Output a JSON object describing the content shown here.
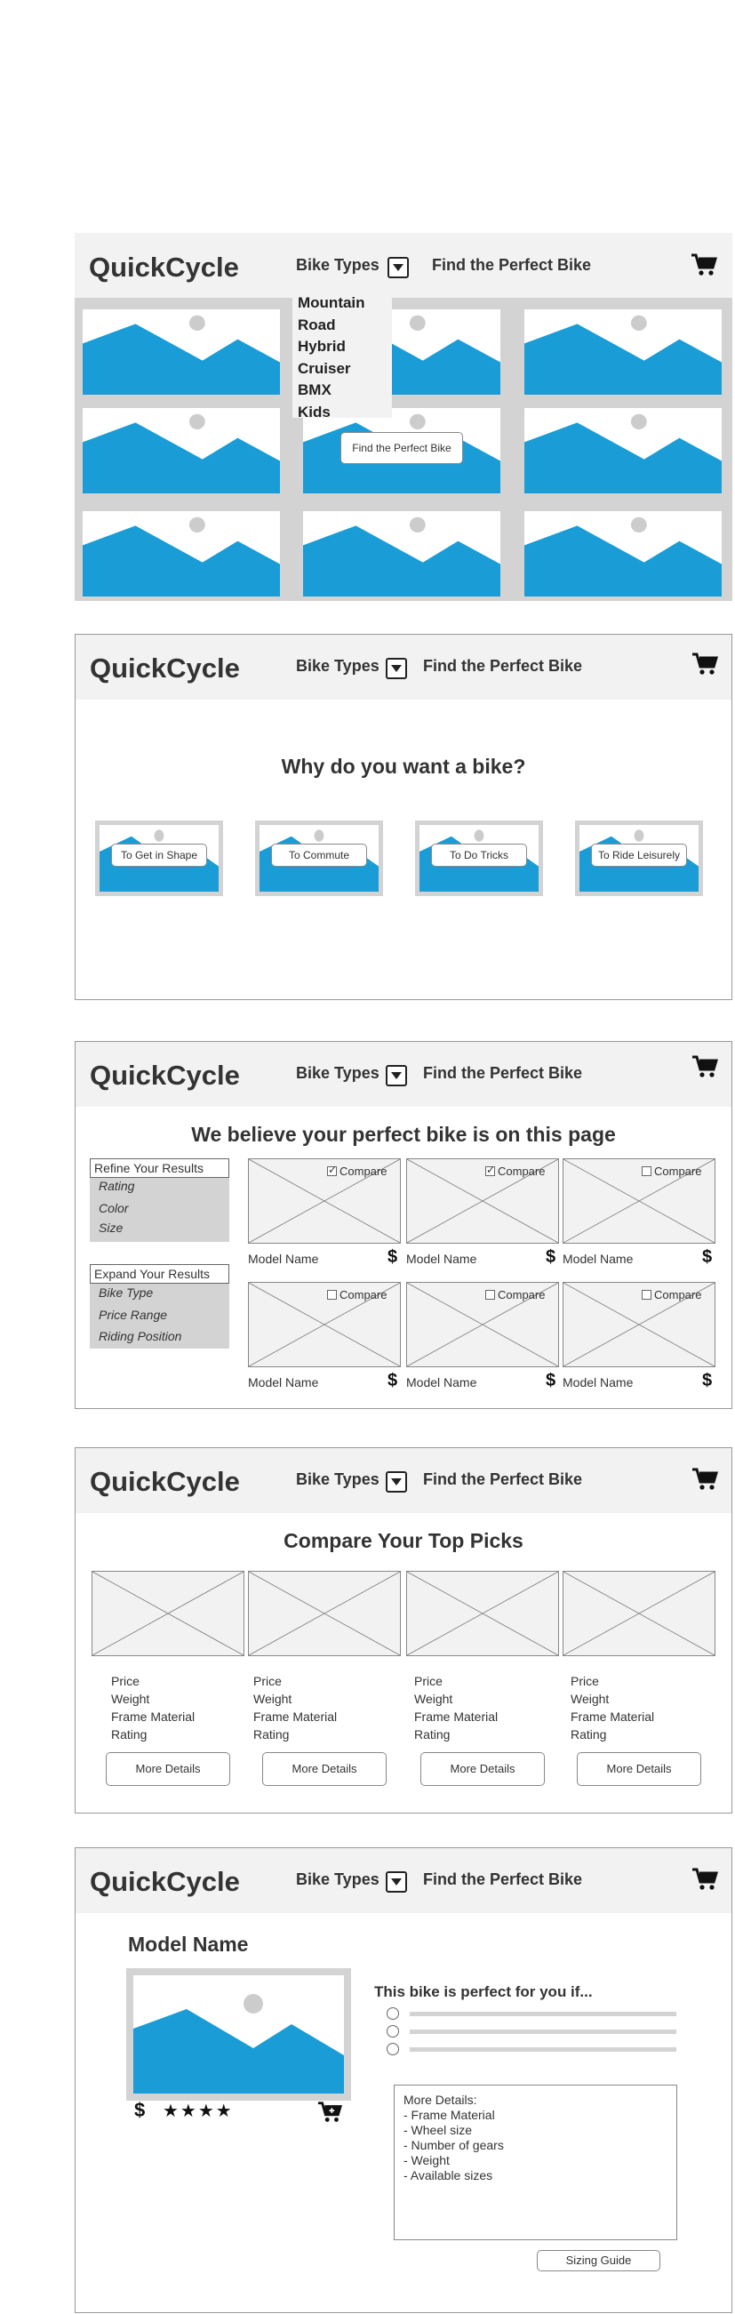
{
  "brand": "QuickCycle",
  "nav": {
    "bike_types": "Bike Types",
    "find_bike": "Find the Perfect Bike"
  },
  "dropdown": {
    "items": [
      "Mountain",
      "Road",
      "Hybrid",
      "Cruiser",
      "BMX",
      "Kids"
    ]
  },
  "screen1": {
    "find_button": "Find the Perfect Bike"
  },
  "screen2": {
    "heading": "Why do you want a bike?",
    "options": [
      "To Get in Shape",
      "To Commute",
      "To Do Tricks",
      "To Ride Leisurely"
    ]
  },
  "screen3": {
    "heading": "We believe your perfect bike is on this page",
    "refine": {
      "title": "Refine Your Results",
      "items": [
        "Rating",
        "Color",
        "Size"
      ]
    },
    "expand": {
      "title": "Expand Your Results",
      "items": [
        "Bike Type",
        "Price Range",
        "Riding Position"
      ]
    },
    "compare_label": "Compare",
    "model_name": "Model Name",
    "currency": "$",
    "compare_checked": [
      true,
      true,
      false,
      false,
      false,
      false
    ]
  },
  "screen4": {
    "heading": "Compare Your Top Picks",
    "specs": [
      "Price",
      "Weight",
      "Frame Material",
      "Rating"
    ],
    "more_details": "More Details"
  },
  "screen5": {
    "model_name": "Model Name",
    "currency": "$",
    "rating": 4,
    "stars": "★★★★",
    "perfect_if": "This bike is perfect for you if...",
    "details_text": "More Details:\n- Frame Material\n- Wheel size\n- Number of gears\n- Weight\n- Available sizes",
    "sizing_guide": "Sizing Guide"
  },
  "colors": {
    "accent": "#1a9cd6",
    "header_bg": "#f2f2f2",
    "placeholder_gray": "#d3d3d3"
  }
}
